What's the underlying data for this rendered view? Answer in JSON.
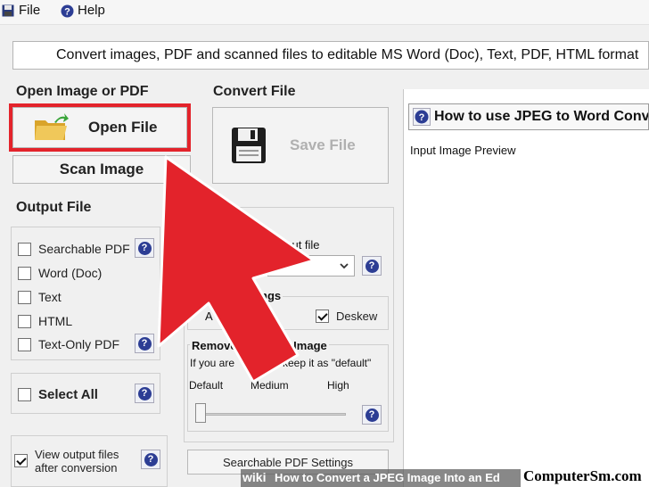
{
  "menubar": {
    "file_label": "File",
    "help_label": "Help"
  },
  "banner_text": "Convert images, PDF and scanned files to editable MS Word (Doc), Text, PDF, HTML format",
  "open_section": {
    "title": "Open Image or PDF",
    "open_button": "Open File",
    "scan_button": "Scan Image"
  },
  "output_section": {
    "title": "Output File",
    "options": [
      {
        "label": "Searchable PDF",
        "checked": false
      },
      {
        "label": "Word (Doc)",
        "checked": false
      },
      {
        "label": "Text",
        "checked": false
      },
      {
        "label": "HTML",
        "checked": false
      },
      {
        "label": "Text-Only PDF",
        "checked": false
      }
    ],
    "select_all": "Select All",
    "view_output_line1": "View output files",
    "view_output_line2": "after conversion"
  },
  "convert_section": {
    "title": "Convert File",
    "save_button": "Save File",
    "input_file_fragment": "nput file",
    "settings_fragment": "ngs",
    "auto_fragment": "A",
    "deskew_label": "Deskew",
    "remove_title_left": "Remove",
    "remove_title_right": "in Image",
    "remove_hint_left": "If you are",
    "remove_hint_right": "keep it as \"default\"",
    "slider_labels": [
      "Default",
      "Medium",
      "High"
    ],
    "slider_level": 0,
    "searchable_pdf_settings": "Searchable PDF Settings"
  },
  "preview": {
    "howto_title": "How to use JPEG to Word Converter",
    "input_preview_label": "Input Image Preview"
  },
  "footer": {
    "wiki": "wiki",
    "text": "How to Convert a JPEG Image Into an Ed"
  },
  "watermark": "ComputerSm.com",
  "colors": {
    "highlight_red": "#e3232b",
    "help_blue": "#2c3d94",
    "folder_yellow": "#e6b93c",
    "arrow_green": "#3aa53a"
  }
}
